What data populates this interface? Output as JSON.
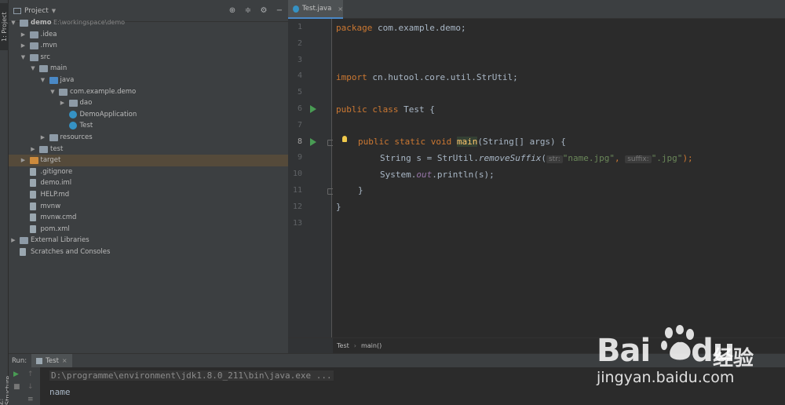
{
  "sidebar": {
    "project_tab": "1: Project",
    "structure_tab": "Z: Structure"
  },
  "project_panel": {
    "title": "Project",
    "tree": [
      {
        "label": "demo",
        "path": "E:\\workingspace\\demo",
        "depth": 0,
        "arrow": "down",
        "icon": "folder"
      },
      {
        "label": ".idea",
        "depth": 1,
        "arrow": "right",
        "icon": "folder"
      },
      {
        "label": ".mvn",
        "depth": 1,
        "arrow": "right",
        "icon": "folder"
      },
      {
        "label": "src",
        "depth": 1,
        "arrow": "down",
        "icon": "folder"
      },
      {
        "label": "main",
        "depth": 2,
        "arrow": "down",
        "icon": "folder"
      },
      {
        "label": "java",
        "depth": 3,
        "arrow": "down",
        "icon": "folder-blue"
      },
      {
        "label": "com.example.demo",
        "depth": 4,
        "arrow": "down",
        "icon": "package"
      },
      {
        "label": "dao",
        "depth": 5,
        "arrow": "right",
        "icon": "package"
      },
      {
        "label": "DemoApplication",
        "depth": 5,
        "arrow": "",
        "icon": "class"
      },
      {
        "label": "Test",
        "depth": 5,
        "arrow": "",
        "icon": "class"
      },
      {
        "label": "resources",
        "depth": 3,
        "arrow": "right",
        "icon": "folder"
      },
      {
        "label": "test",
        "depth": 2,
        "arrow": "right",
        "icon": "folder"
      },
      {
        "label": "target",
        "depth": 1,
        "arrow": "right",
        "icon": "folder-orange"
      },
      {
        "label": ".gitignore",
        "depth": 1,
        "arrow": "",
        "icon": "file"
      },
      {
        "label": "demo.iml",
        "depth": 1,
        "arrow": "",
        "icon": "file"
      },
      {
        "label": "HELP.md",
        "depth": 1,
        "arrow": "",
        "icon": "file"
      },
      {
        "label": "mvnw",
        "depth": 1,
        "arrow": "",
        "icon": "file"
      },
      {
        "label": "mvnw.cmd",
        "depth": 1,
        "arrow": "",
        "icon": "file"
      },
      {
        "label": "pom.xml",
        "depth": 1,
        "arrow": "",
        "icon": "maven"
      },
      {
        "label": "External Libraries",
        "depth": 0,
        "arrow": "right",
        "icon": "library"
      },
      {
        "label": "Scratches and Consoles",
        "depth": 0,
        "arrow": "",
        "icon": "scratch"
      }
    ]
  },
  "editor": {
    "tab_label": "Test.java",
    "line_numbers": [
      "1",
      "2",
      "3",
      "4",
      "5",
      "6",
      "7",
      "8",
      "9",
      "10",
      "11",
      "12",
      "13"
    ],
    "code": {
      "l1_kw": "package",
      "l1_rest": " com.example.demo;",
      "l4_kw": "import",
      "l4_rest": " cn.hutool.core.util.StrUtil;",
      "l6_kw": "public class",
      "l6_rest": " Test {",
      "l8_kw": "public static void",
      "l8_fn": "main",
      "l8_rest": "(String[] args) {",
      "l9_a": "String s = StrUtil.",
      "l9_method": "removeSuffix",
      "l9_paren": "(",
      "l9_hint1": "str:",
      "l9_str1": "\"name.jpg\"",
      "l9_comma": ", ",
      "l9_hint2": "suffix:",
      "l9_str2": "\".jpg\"",
      "l9_end": ");",
      "l10_a": "System.",
      "l10_out": "out",
      "l10_rest": ".println(s);",
      "l11": "}",
      "l12": "}"
    },
    "breadcrumb": [
      "Test",
      "main()"
    ]
  },
  "run_panel": {
    "label": "Run:",
    "tab": "Test",
    "console_lines": [
      "D:\\programme\\environment\\jdk1.8.0_211\\bin\\java.exe ...",
      "name"
    ]
  },
  "watermark": {
    "brand": "Bai du",
    "brand_a": "Bai",
    "brand_b": "du",
    "cn": "经验",
    "url": "jingyan.baidu.com"
  }
}
